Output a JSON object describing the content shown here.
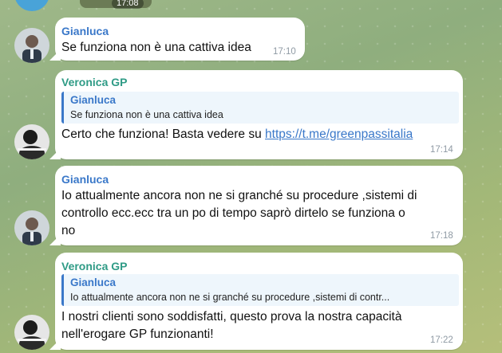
{
  "top": {
    "time": "17:08"
  },
  "messages": [
    {
      "sender": "Gianluca",
      "lines": [
        "Se funziona non è una cattiva idea"
      ],
      "time": "17:10"
    },
    {
      "sender": "Veronica GP",
      "reply": {
        "name": "Gianluca",
        "text": "Se funziona non è una cattiva idea"
      },
      "text_prefix": "Certo che funziona! Basta vedere su ",
      "link": "https://t.me/greenpassitalia",
      "time": "17:14"
    },
    {
      "sender": "Gianluca",
      "lines": [
        "Io attualmente ancora non ne si granché su procedure ,sistemi di",
        "controllo ecc.ecc  tra un po di tempo saprò dirtelo se funziona o",
        "no"
      ],
      "time": "17:18"
    },
    {
      "sender": "Veronica GP",
      "reply": {
        "name": "Gianluca",
        "text": "Io attualmente ancora non ne si granché su procedure ,sistemi di contr..."
      },
      "lines": [
        "I nostri clienti sono soddisfatti, questo prova la nostra capacità",
        "nell'erogare GP funzionanti!"
      ],
      "time": "17:22"
    }
  ],
  "colors": {
    "gianluca_name": "#3a78c9",
    "veronica_name": "#2f9b86",
    "bubble": "#ffffff"
  }
}
